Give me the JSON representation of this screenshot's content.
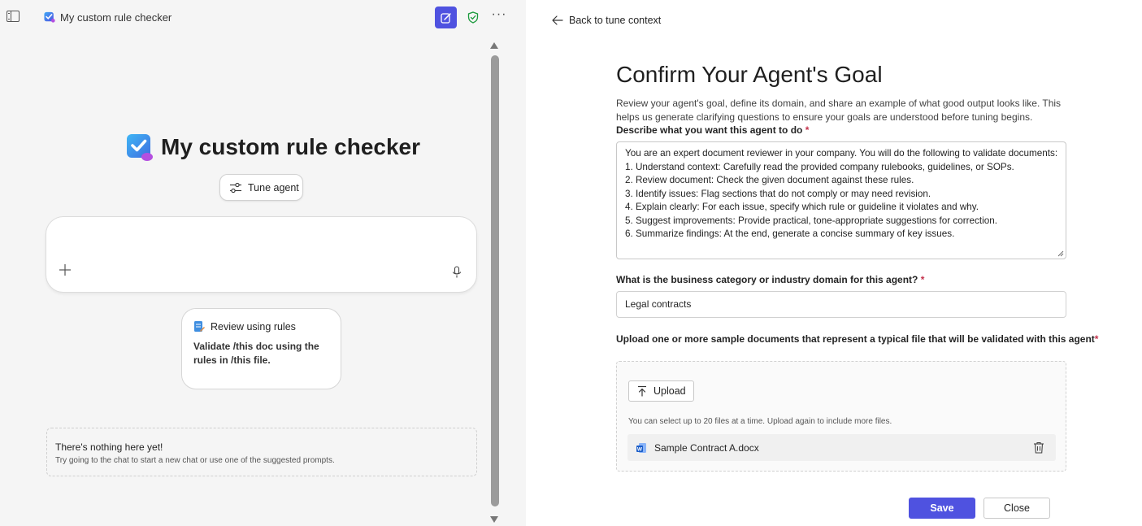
{
  "app": {
    "title": "My custom rule checker"
  },
  "left": {
    "hero_title": "My custom rule checker",
    "tune_label": "Tune agent",
    "composer_value": "",
    "prompt_card": {
      "title": "Review using rules",
      "body": "Validate /this doc using the rules in /this file."
    },
    "empty_state": {
      "title": "There's nothing here yet!",
      "subtitle": "Try going to the chat to start a new chat or use one of the suggested prompts."
    }
  },
  "right": {
    "back_label": "Back to tune context",
    "title": "Confirm Your Agent's Goal",
    "intro": "Review your agent's goal, define its domain, and share an example of what good output looks like. This helps us generate clarifying questions to ensure your goals are understood before tuning begins.",
    "goal_label": "Describe what you want this agent to do",
    "goal_lines": [
      "You are an expert document reviewer in your company. You will do the following to validate documents:",
      "1. Understand context: Carefully read the provided company rulebooks, guidelines, or SOPs.",
      "2. Review document: Check the given document against these rules.",
      "3. Identify issues: Flag sections that do not comply or may need revision.",
      "4. Explain clearly: For each issue, specify which rule or guideline it violates and why.",
      "5. Suggest improvements: Provide practical, tone-appropriate suggestions for correction.",
      "6. Summarize findings: At the end, generate a concise summary of key issues."
    ],
    "domain_label": "What is the business category or industry domain for this agent?",
    "domain_value": "Legal contracts",
    "upload_label": "Upload one or more sample documents that represent a typical file that will be validated with this agent",
    "required_marker": "*",
    "upload_button": "Upload",
    "upload_hint": "You can select up to 20 files at a time. Upload again to include more files.",
    "files": [
      {
        "name": "Sample Contract A.docx"
      }
    ],
    "save_label": "Save",
    "close_label": "Close"
  },
  "colors": {
    "accent": "#4f52e0",
    "required": "#c4314b",
    "shield": "#1a9a3c"
  },
  "icons": [
    "sidebar-toggle-icon",
    "app-logo-icon",
    "new-chat-icon",
    "shield-check-icon",
    "more-icon",
    "tune-icon",
    "plus-icon",
    "mic-icon",
    "notebook-icon",
    "back-arrow-icon",
    "upload-icon",
    "word-doc-icon",
    "trash-icon"
  ]
}
